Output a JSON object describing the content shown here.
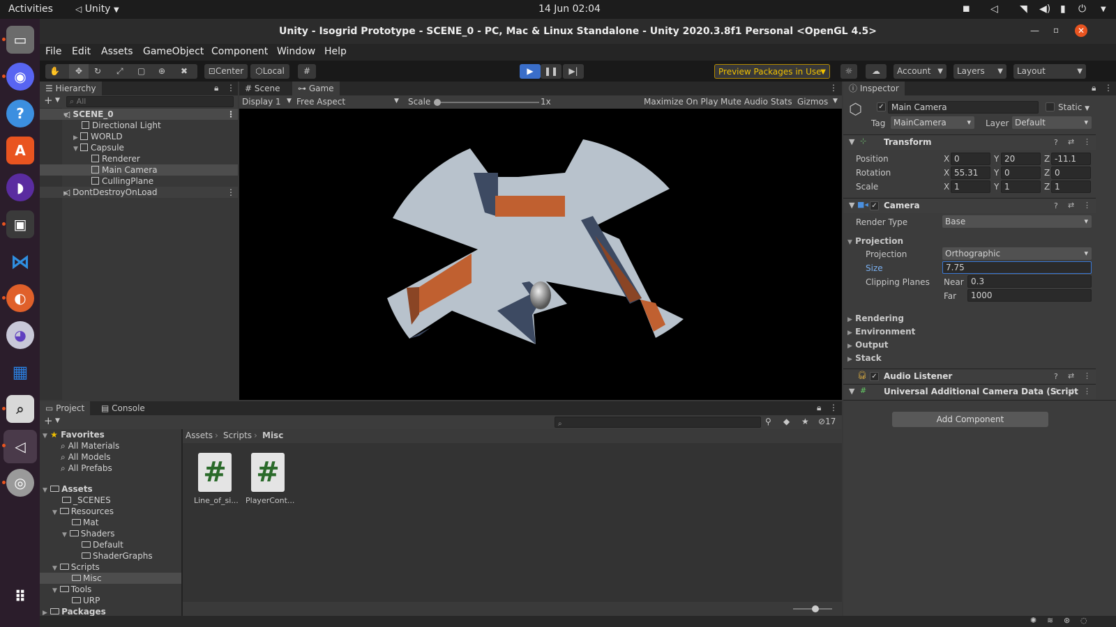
{
  "system_bar": {
    "activities": "Activities",
    "app_menu": "Unity",
    "clock": "14 Jun  02:04"
  },
  "window": {
    "title": "Unity - Isogrid Prototype - SCENE_0 - PC, Mac & Linux Standalone - Unity 2020.3.8f1 Personal <OpenGL 4.5>"
  },
  "menu": [
    "File",
    "Edit",
    "Assets",
    "GameObject",
    "Component",
    "Window",
    "Help"
  ],
  "toolbar": {
    "pivot": "Center",
    "space": "Local",
    "preview_packages": "Preview Packages in Use",
    "account": "Account",
    "layers": "Layers",
    "layout": "Layout"
  },
  "hierarchy": {
    "tab": "Hierarchy",
    "search_placeholder": "All",
    "items": [
      {
        "label": "SCENE_0"
      },
      {
        "label": "Directional Light"
      },
      {
        "label": "WORLD"
      },
      {
        "label": "Capsule"
      },
      {
        "label": "Renderer"
      },
      {
        "label": "Main Camera"
      },
      {
        "label": "CullingPlane"
      },
      {
        "label": "DontDestroyOnLoad"
      }
    ]
  },
  "game_view": {
    "tab_scene": "Scene",
    "tab_game": "Game",
    "display": "Display 1",
    "aspect": "Free Aspect",
    "scale_label": "Scale",
    "scale_value": "1x",
    "scale_slider_fraction": 0,
    "maximize": "Maximize On Play",
    "mute": "Mute Audio",
    "stats": "Stats",
    "gizmos": "Gizmos"
  },
  "inspector": {
    "tab": "Inspector",
    "object_name": "Main Camera",
    "static_label": "Static",
    "tag_label": "Tag",
    "tag_value": "MainCamera",
    "layer_label": "Layer",
    "layer_value": "Default",
    "transform": {
      "title": "Transform",
      "position_label": "Position",
      "rotation_label": "Rotation",
      "scale_label": "Scale",
      "x": "X",
      "y": "Y",
      "z": "Z",
      "position": [
        "0",
        "20",
        "-11.1"
      ],
      "rotation": [
        "55.31",
        "0",
        "0"
      ],
      "scale": [
        "1",
        "1",
        "1"
      ]
    },
    "camera": {
      "title": "Camera",
      "render_type_label": "Render Type",
      "render_type": "Base",
      "projection_header": "Projection",
      "projection_label": "Projection",
      "projection_value": "Orthographic",
      "size_label": "Size",
      "size_value": "7.75",
      "clipping_label": "Clipping Planes",
      "near_label": "Near",
      "near_value": "0.3",
      "far_label": "Far",
      "far_value": "1000",
      "sections": [
        "Rendering",
        "Environment",
        "Output",
        "Stack"
      ]
    },
    "audio_listener": "Audio Listener",
    "additional_data": "Universal Additional Camera Data (Script",
    "add_component": "Add Component"
  },
  "project": {
    "tab_project": "Project",
    "tab_console": "Console",
    "hidden_count": "17",
    "favorites_header": "Favorites",
    "favorites": [
      "All Materials",
      "All Models",
      "All Prefabs"
    ],
    "assets_header": "Assets",
    "tree": [
      {
        "label": "_SCENES",
        "level": 1
      },
      {
        "label": "Resources",
        "level": 1
      },
      {
        "label": "Mat",
        "level": 2
      },
      {
        "label": "Shaders",
        "level": 2
      },
      {
        "label": "Default",
        "level": 3
      },
      {
        "label": "ShaderGraphs",
        "level": 3
      },
      {
        "label": "Scripts",
        "level": 1
      },
      {
        "label": "Misc",
        "level": 2
      },
      {
        "label": "Tools",
        "level": 1
      },
      {
        "label": "URP",
        "level": 2
      }
    ],
    "packages_header": "Packages",
    "breadcrumb": [
      "Assets",
      "Scripts",
      "Misc"
    ],
    "files": [
      "Line_of_si...",
      "PlayerCont..."
    ]
  }
}
